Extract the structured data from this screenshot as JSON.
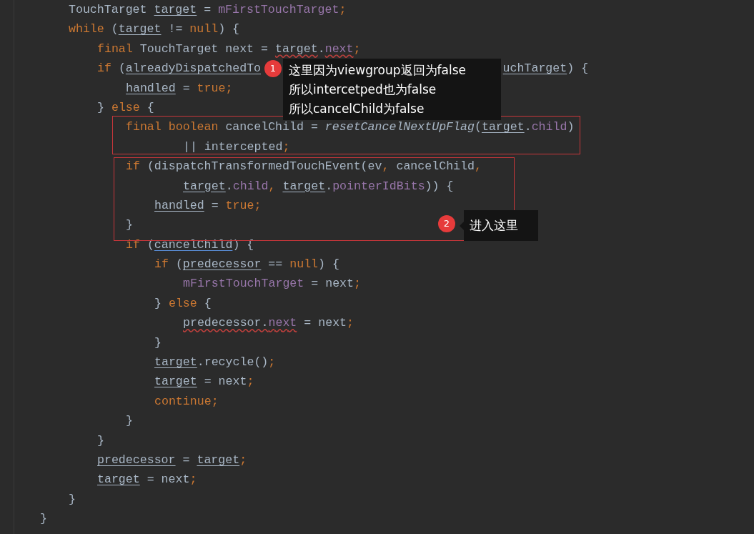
{
  "editor": {
    "lines": [
      {
        "children": [
          {
            "tokens": [
              {
                "t": "TouchTarget ",
                "kind": "plain"
              },
              {
                "t": "target",
                "kind": "var"
              },
              {
                "t": " = ",
                "kind": "plain"
              },
              {
                "t": "mFirstTouchTarget",
                "kind": "field"
              },
              {
                "t": ";",
                "kind": "kw"
              }
            ]
          },
          {
            "tokens": [
              {
                "t": "while",
                "kind": "kw"
              },
              {
                "t": " (",
                "kind": "plain"
              },
              {
                "t": "target",
                "kind": "var"
              },
              {
                "t": " != ",
                "kind": "plain"
              },
              {
                "t": "null",
                "kind": "kw"
              },
              {
                "t": ") {",
                "kind": "plain"
              }
            ],
            "children": [
              {
                "tokens": [
                  {
                    "t": "final",
                    "kind": "kw"
                  },
                  {
                    "t": " TouchTarget next = ",
                    "kind": "plain"
                  },
                  {
                    "t": "target",
                    "kind": "warn"
                  },
                  {
                    "t": ".",
                    "kind": "plain"
                  },
                  {
                    "t": "next",
                    "kind": "warnfield"
                  },
                  {
                    "t": ";",
                    "kind": "kw"
                  }
                ]
              },
              {
                "tokens": [
                  {
                    "t": "if",
                    "kind": "kw"
                  },
                  {
                    "t": " (",
                    "kind": "plain"
                  },
                  {
                    "t": "alreadyDispatchedTo",
                    "kind": "var"
                  }
                ],
                "tail": [
                  {
                    "t": "uchTarget",
                    "kind": "var"
                  },
                  {
                    "t": ") {",
                    "kind": "plain"
                  }
                ],
                "children": [
                  {
                    "tokens": [
                      {
                        "t": "handled",
                        "kind": "var"
                      },
                      {
                        "t": " = ",
                        "kind": "plain"
                      },
                      {
                        "t": "true",
                        "kind": "kw"
                      },
                      {
                        "t": ";",
                        "kind": "kw"
                      }
                    ]
                  }
                ]
              },
              {
                "tokens": [
                  {
                    "t": "} ",
                    "kind": "plain"
                  },
                  {
                    "t": "else",
                    "kind": "kw"
                  },
                  {
                    "t": " {",
                    "kind": "plain"
                  }
                ],
                "children": [
                  {
                    "tokens": [
                      {
                        "t": "final boolean",
                        "kind": "kw"
                      },
                      {
                        "t": " cancelChild = ",
                        "kind": "plain"
                      },
                      {
                        "t": "resetCancelNextUpFlag",
                        "kind": "call"
                      },
                      {
                        "t": "(",
                        "kind": "plain"
                      },
                      {
                        "t": "target",
                        "kind": "var"
                      },
                      {
                        "t": ".",
                        "kind": "plain"
                      },
                      {
                        "t": "child",
                        "kind": "field"
                      },
                      {
                        "t": ")",
                        "kind": "plain"
                      }
                    ],
                    "wrap": [
                      {
                        "tokens": [
                          {
                            "t": "|| intercepted",
                            "kind": "plain"
                          },
                          {
                            "t": ";",
                            "kind": "kw"
                          }
                        ]
                      }
                    ]
                  },
                  {
                    "tokens": [
                      {
                        "t": "if",
                        "kind": "kw"
                      },
                      {
                        "t": " (dispatchTransformedTouchEvent(ev",
                        "kind": "plain"
                      },
                      {
                        "t": ",",
                        "kind": "kw"
                      },
                      {
                        "t": " cancelChild",
                        "kind": "plain"
                      },
                      {
                        "t": ",",
                        "kind": "kw"
                      }
                    ],
                    "wrap": [
                      {
                        "tokens": [
                          {
                            "t": "target",
                            "kind": "var"
                          },
                          {
                            "t": ".",
                            "kind": "plain"
                          },
                          {
                            "t": "child",
                            "kind": "field"
                          },
                          {
                            "t": ", ",
                            "kind": "kw"
                          },
                          {
                            "t": "target",
                            "kind": "var"
                          },
                          {
                            "t": ".",
                            "kind": "plain"
                          },
                          {
                            "t": "pointerIdBits",
                            "kind": "field"
                          },
                          {
                            "t": ")) {",
                            "kind": "plain"
                          }
                        ]
                      }
                    ],
                    "children": [
                      {
                        "tokens": [
                          {
                            "t": "handled",
                            "kind": "var"
                          },
                          {
                            "t": " = ",
                            "kind": "plain"
                          },
                          {
                            "t": "true",
                            "kind": "kw"
                          },
                          {
                            "t": ";",
                            "kind": "kw"
                          }
                        ]
                      }
                    ]
                  },
                  {
                    "tokens": [
                      {
                        "t": "}",
                        "kind": "plain"
                      }
                    ]
                  },
                  {
                    "tokens": [
                      {
                        "t": "if",
                        "kind": "kw"
                      },
                      {
                        "t": " (",
                        "kind": "plain"
                      },
                      {
                        "t": "cancelChild",
                        "kind": "link"
                      },
                      {
                        "t": ") {",
                        "kind": "plain"
                      }
                    ],
                    "children": [
                      {
                        "tokens": [
                          {
                            "t": "if",
                            "kind": "kw"
                          },
                          {
                            "t": " (",
                            "kind": "plain"
                          },
                          {
                            "t": "predecessor",
                            "kind": "var"
                          },
                          {
                            "t": " == ",
                            "kind": "plain"
                          },
                          {
                            "t": "null",
                            "kind": "kw"
                          },
                          {
                            "t": ") {",
                            "kind": "plain"
                          }
                        ],
                        "children": [
                          {
                            "tokens": [
                              {
                                "t": "mFirstTouchTarget",
                                "kind": "field"
                              },
                              {
                                "t": " = next",
                                "kind": "plain"
                              },
                              {
                                "t": ";",
                                "kind": "kw"
                              }
                            ]
                          }
                        ]
                      },
                      {
                        "tokens": [
                          {
                            "t": "} ",
                            "kind": "plain"
                          },
                          {
                            "t": "else",
                            "kind": "kw"
                          },
                          {
                            "t": " {",
                            "kind": "plain"
                          }
                        ],
                        "children": [
                          {
                            "tokens": [
                              {
                                "t": "predecessor.",
                                "kind": "warn"
                              },
                              {
                                "t": "next",
                                "kind": "warnfield"
                              },
                              {
                                "t": " = next",
                                "kind": "plain"
                              },
                              {
                                "t": ";",
                                "kind": "kw"
                              }
                            ]
                          }
                        ]
                      },
                      {
                        "tokens": [
                          {
                            "t": "}",
                            "kind": "plain"
                          }
                        ]
                      },
                      {
                        "tokens": [
                          {
                            "t": "target",
                            "kind": "var"
                          },
                          {
                            "t": ".recycle()",
                            "kind": "plain"
                          },
                          {
                            "t": ";",
                            "kind": "kw"
                          }
                        ]
                      },
                      {
                        "tokens": [
                          {
                            "t": "target",
                            "kind": "var"
                          },
                          {
                            "t": " = next",
                            "kind": "plain"
                          },
                          {
                            "t": ";",
                            "kind": "kw"
                          }
                        ]
                      },
                      {
                        "tokens": [
                          {
                            "t": "continue;",
                            "kind": "kw"
                          }
                        ]
                      }
                    ]
                  },
                  {
                    "tokens": [
                      {
                        "t": "}",
                        "kind": "plain"
                      }
                    ]
                  }
                ]
              },
              {
                "tokens": [
                  {
                    "t": "}",
                    "kind": "plain"
                  }
                ]
              },
              {
                "tokens": [
                  {
                    "t": "predecessor",
                    "kind": "var"
                  },
                  {
                    "t": " = ",
                    "kind": "plain"
                  },
                  {
                    "t": "target",
                    "kind": "var"
                  },
                  {
                    "t": ";",
                    "kind": "kw"
                  }
                ]
              },
              {
                "tokens": [
                  {
                    "t": "target",
                    "kind": "var"
                  },
                  {
                    "t": " = next",
                    "kind": "plain"
                  },
                  {
                    "t": ";",
                    "kind": "kw"
                  }
                ]
              }
            ]
          },
          {
            "tokens": [
              {
                "t": "}",
                "kind": "plain"
              }
            ]
          }
        ]
      },
      {
        "tokens": [
          {
            "t": "}",
            "kind": "plain"
          }
        ]
      }
    ]
  },
  "callouts": [
    {
      "number": "1",
      "lines": [
        "这里因为viewgroup返回为false",
        "所以intercetped也为false",
        "所以cancelChild为false"
      ]
    },
    {
      "number": "2",
      "lines": [
        "进入这里"
      ]
    }
  ]
}
